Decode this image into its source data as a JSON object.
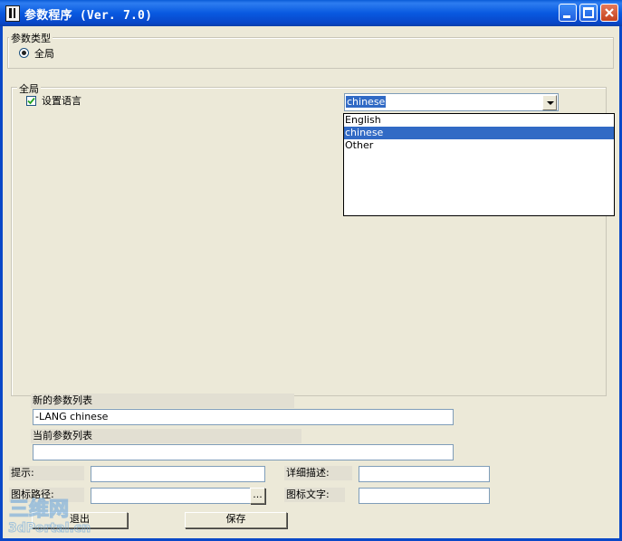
{
  "window": {
    "title": "参数程序 (Ver. 7.0)"
  },
  "params_type": {
    "legend": "参数类型",
    "option_label": "全局"
  },
  "global": {
    "legend": "全局",
    "set_language_label": "设置语言",
    "language_selected": "chinese",
    "language_options": [
      "English",
      "chinese",
      "Other"
    ]
  },
  "new_params": {
    "label": "新的参数列表",
    "value": "-LANG chinese"
  },
  "current_params": {
    "label": "当前参数列表",
    "value": ""
  },
  "tip": {
    "label": "提示:",
    "value": ""
  },
  "detail": {
    "label": "详细描述:",
    "value": ""
  },
  "icon_path": {
    "label": "图标路径:",
    "value": "",
    "browse_label": "..."
  },
  "icon_text": {
    "label": "图标文字:",
    "value": ""
  },
  "buttons": {
    "exit_label": "退出",
    "save_label": "保存"
  },
  "watermark": {
    "top": "三维网",
    "bottom": "3dPortal.cn"
  }
}
